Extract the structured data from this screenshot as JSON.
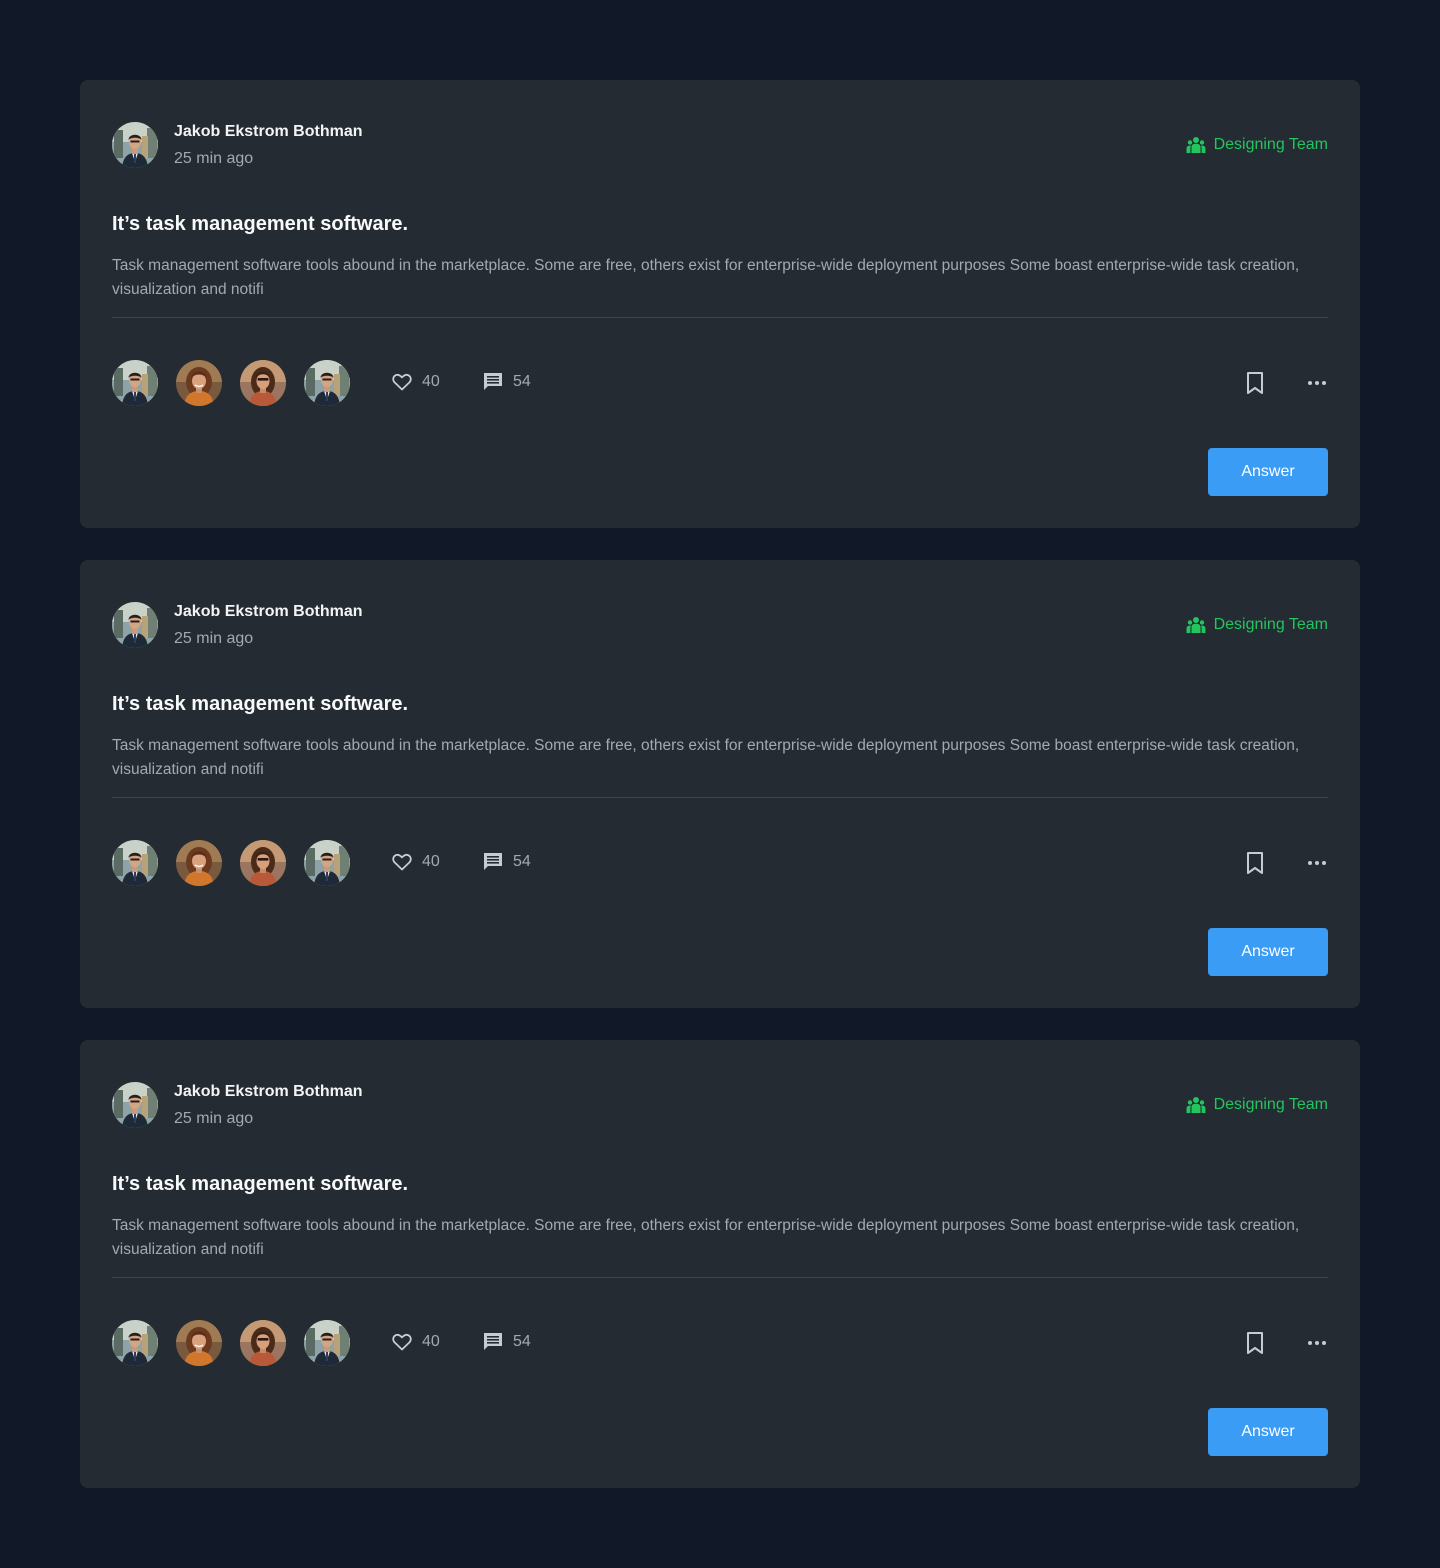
{
  "colors": {
    "page_background": "#111827",
    "card_background": "#242b33",
    "team_green": "#22c55e",
    "answer_blue": "#3b9cf6"
  },
  "posts": [
    {
      "author": "Jakob Ekstrom Bothman",
      "time": "25 min ago",
      "team": "Designing Team",
      "team_icon": "users-group-icon",
      "title": "It’s task management software.",
      "body": "Task management software tools abound in the marketplace. Some are free, others exist for enterprise-wide deployment purposes Some boast enterprise-wide task creation, visualization and notifi",
      "likes": "40",
      "comments": "54",
      "answer_label": "Answer"
    },
    {
      "author": "Jakob Ekstrom Bothman",
      "time": "25 min ago",
      "team": "Designing Team",
      "team_icon": "users-group-icon",
      "title": "It’s task management software.",
      "body": "Task management software tools abound in the marketplace. Some are free, others exist for enterprise-wide deployment purposes Some boast enterprise-wide task creation, visualization and notifi",
      "likes": "40",
      "comments": "54",
      "answer_label": "Answer"
    },
    {
      "author": "Jakob Ekstrom Bothman",
      "time": "25 min ago",
      "team": "Designing Team",
      "team_icon": "users-group-icon",
      "title": "It’s task management software.",
      "body": "Task management software tools abound in the marketplace. Some are free, others exist for enterprise-wide deployment purposes Some boast enterprise-wide task creation, visualization and notifi",
      "likes": "40",
      "comments": "54",
      "answer_label": "Answer"
    }
  ]
}
